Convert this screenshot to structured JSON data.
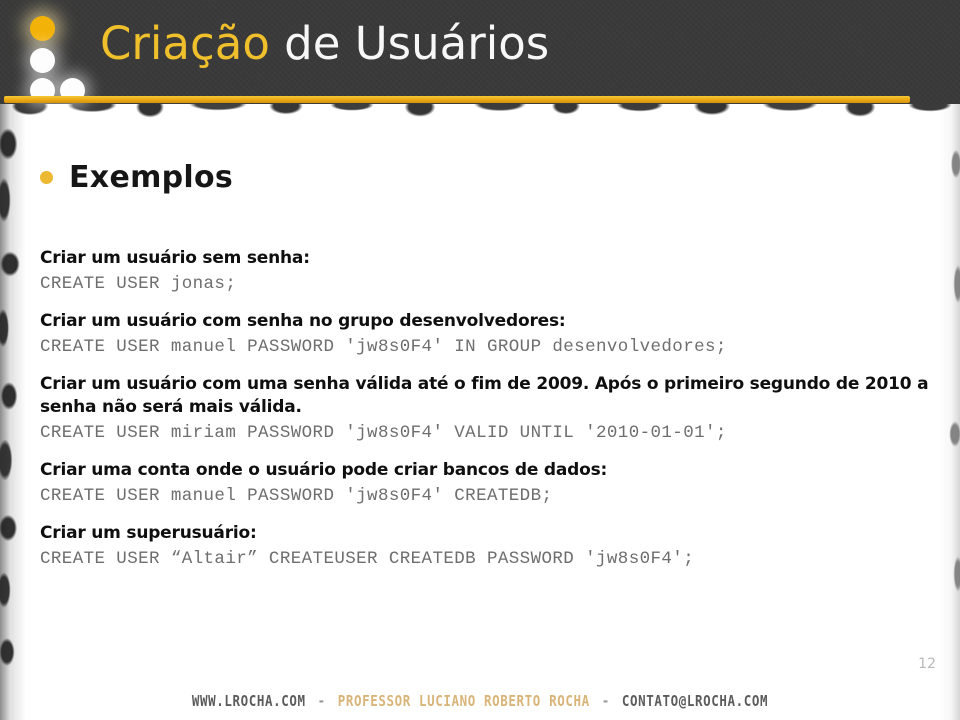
{
  "header": {
    "title_highlight": "Criação",
    "title_rest": "de Usuários",
    "logo_name": "lrocha-dots-logo",
    "colors": {
      "background": "#3a3a3a",
      "highlight": "#f0c02c",
      "rest": "#f7f7f7",
      "rule": "#efae16"
    }
  },
  "section": {
    "bullet_color": "#edb932",
    "title": "Exemplos"
  },
  "examples": [
    {
      "description": "Criar um usuário sem senha:",
      "code": "CREATE USER jonas;"
    },
    {
      "description": "Criar um usuário com senha no grupo desenvolvedores:",
      "code": "CREATE USER manuel PASSWORD 'jw8s0F4' IN GROUP desenvolvedores;"
    },
    {
      "description": "Criar um usuário com uma senha válida até o fim de 2009. Após o primeiro segundo de 2010 a senha não será mais válida.",
      "code": "CREATE USER miriam PASSWORD 'jw8s0F4' VALID UNTIL '2010-01-01';"
    },
    {
      "description": "Criar uma conta onde o usuário pode criar bancos de dados:",
      "code": "CREATE USER manuel PASSWORD 'jw8s0F4' CREATEDB;"
    },
    {
      "description": "Criar um superusuário:",
      "code": "CREATE USER “Altair” CREATEUSER CREATEDB PASSWORD 'jw8s0F4';"
    }
  ],
  "page_number": "12",
  "footer": {
    "site": "WWW.LROCHA.COM",
    "separator_left": "-",
    "author": "PROFESSOR LUCIANO ROBERTO ROCHA",
    "separator_right": "-",
    "email": "CONTATO@LROCHA.COM",
    "author_color": "#d8b478"
  }
}
